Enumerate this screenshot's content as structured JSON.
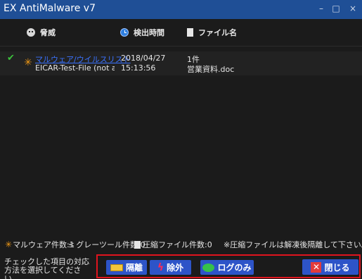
{
  "window": {
    "title": "EX AntiMalware v7",
    "min_glyph": "–",
    "max_glyph": "□",
    "close_glyph": "×"
  },
  "columns": [
    {
      "label": "脅威",
      "icon": "skull-icon"
    },
    {
      "label": "検出時間",
      "icon": "clock-icon"
    },
    {
      "label": "ファイル名",
      "icon": "file-icon"
    }
  ],
  "rows": [
    {
      "checked": true,
      "check_glyph": "✔",
      "type_icon": "malware-icon",
      "type_glyph": "✳",
      "threat_link": "マルウェア/ウイルスリスト",
      "threat_name": "EICAR-Test-File (not a virus)",
      "date": "2018/04/27",
      "time": "15:13:56",
      "count": "1件",
      "file": "営業資料.doc"
    }
  ],
  "status": {
    "malware_glyph": "✳",
    "malware": "マルウェア件数:1",
    "greyware_glyph": "≤",
    "greyware": "グレーツール件数:0",
    "compressed": "圧縮ファイル件数:0",
    "note": "※圧縮ファイルは解凍後隔離して下さい。"
  },
  "footer": {
    "prompt": "チェックした項目の対応方法を選択してください。"
  },
  "buttons": {
    "quarantine": "隔離",
    "exclude": "除外",
    "exclude_glyph": "ϟ",
    "log_only": "ログのみ",
    "close": "閉じる",
    "close_glyph": "✕"
  },
  "colors": {
    "titlebar": "#1f4f96",
    "background": "#1b1b1b",
    "button": "#2d54c8",
    "highlight_frame": "#e0141e",
    "link": "#3b73ff",
    "malware_orange": "#f29b16",
    "check_green": "#3cc23c"
  }
}
